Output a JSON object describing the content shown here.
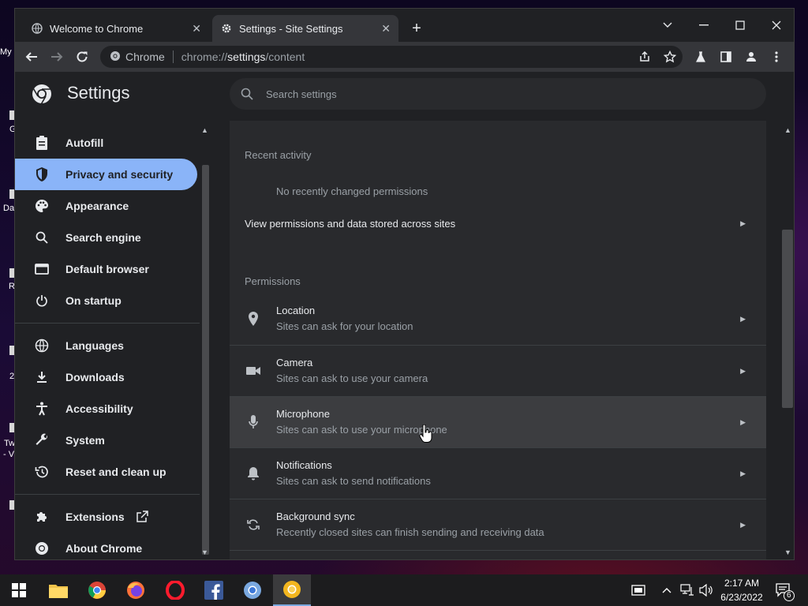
{
  "desktop": {
    "labels": [
      "My",
      "G",
      "Dat",
      "R",
      "2",
      "Tw",
      "- V"
    ]
  },
  "browser": {
    "tabs": [
      {
        "title": "Welcome to Chrome",
        "icon": "globe-icon",
        "close": "✕"
      },
      {
        "title": "Settings - Site Settings",
        "icon": "gear-icon",
        "close": "✕"
      }
    ],
    "new_tab": "+",
    "omnibox": {
      "site_label": "Chrome",
      "url_prefix": "chrome://",
      "url_host": "settings",
      "url_path": "/content"
    }
  },
  "settings": {
    "title": "Settings",
    "search_placeholder": "Search settings",
    "nav": [
      {
        "label": "Autofill",
        "icon": "clipboard-icon"
      },
      {
        "label": "Privacy and security",
        "icon": "shield-icon",
        "selected": true
      },
      {
        "label": "Appearance",
        "icon": "palette-icon"
      },
      {
        "label": "Search engine",
        "icon": "search-icon"
      },
      {
        "label": "Default browser",
        "icon": "browser-window-icon"
      },
      {
        "label": "On startup",
        "icon": "power-icon"
      },
      {
        "label": "Languages",
        "icon": "globe-icon"
      },
      {
        "label": "Downloads",
        "icon": "download-icon"
      },
      {
        "label": "Accessibility",
        "icon": "accessibility-icon"
      },
      {
        "label": "System",
        "icon": "wrench-icon"
      },
      {
        "label": "Reset and clean up",
        "icon": "history-icon"
      },
      {
        "label": "Extensions",
        "icon": "puzzle-icon"
      },
      {
        "label": "About Chrome",
        "icon": "chrome-logo-icon"
      }
    ],
    "recent_activity": {
      "title": "Recent activity",
      "empty_text": "No recently changed permissions",
      "view_link": "View permissions and data stored across sites"
    },
    "permissions": {
      "title": "Permissions",
      "items": [
        {
          "title": "Location",
          "subtitle": "Sites can ask for your location",
          "icon": "location-pin-icon"
        },
        {
          "title": "Camera",
          "subtitle": "Sites can ask to use your camera",
          "icon": "camera-icon"
        },
        {
          "title": "Microphone",
          "subtitle": "Sites can ask to use your microphone",
          "icon": "microphone-icon",
          "hovered": true
        },
        {
          "title": "Notifications",
          "subtitle": "Sites can ask to send notifications",
          "icon": "bell-icon"
        },
        {
          "title": "Background sync",
          "subtitle": "Recently closed sites can finish sending and receiving data",
          "icon": "sync-icon"
        }
      ]
    }
  },
  "taskbar": {
    "apps": [
      "windows-start-icon",
      "file-explorer-icon",
      "chrome-icon",
      "firefox-icon",
      "opera-icon",
      "facebook-icon",
      "chromium-icon",
      "chrome-canary-icon"
    ],
    "time": "2:17 AM",
    "date": "6/23/2022",
    "notification_count": "6"
  },
  "colors": {
    "accent": "#8ab4f8",
    "background": "#202124",
    "card": "#292a2d"
  }
}
